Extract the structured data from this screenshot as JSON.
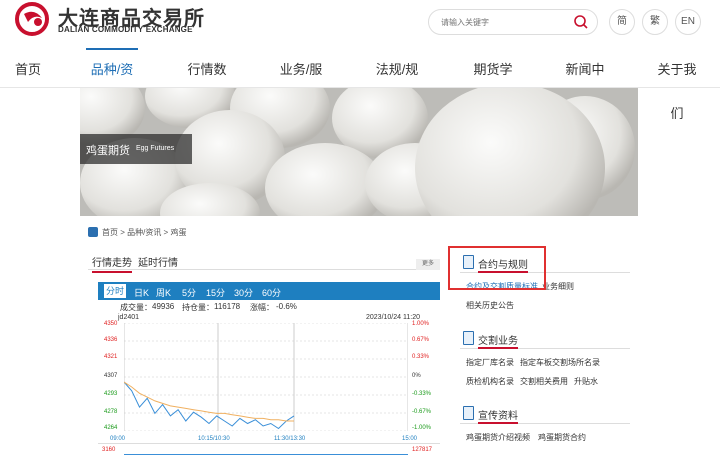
{
  "header": {
    "logo_cn": "大连商品交易所",
    "logo_en": "DALIAN COMMODITY EXCHANGE",
    "search_placeholder": "请输入关键字",
    "lang_simplified": "简",
    "lang_traditional": "繁",
    "lang_english": "EN"
  },
  "nav": {
    "items": [
      "首页",
      "品种/资讯",
      "行情数据",
      "业务/服务",
      "法规/规则",
      "期货学苑",
      "新闻中心",
      "关于我们"
    ],
    "active_index": 1
  },
  "banner": {
    "title_cn": "鸡蛋期货",
    "title_en": "Egg Futures"
  },
  "breadcrumb": "首页 > 品种/资讯 > 鸡蛋",
  "market": {
    "tabs": [
      "行情走势",
      "延时行情"
    ],
    "more": "更多",
    "periods": [
      "分时",
      "日K",
      "周K",
      "5分",
      "15分",
      "30分",
      "60分"
    ],
    "volume_label": "成交量：",
    "volume": "49936",
    "open_interest_label": "持仓量：",
    "open_interest": "116178",
    "change_label": "涨幅：",
    "change": "-0.6%",
    "symbol": "jd2401",
    "datetime": "2023/10/24 11:20",
    "bottom_left": "3160",
    "bottom_right": "127817"
  },
  "chart_data": {
    "type": "line",
    "y_ticks_left": [
      "4350",
      "4336",
      "4321",
      "4307",
      "4293",
      "4278",
      "4264"
    ],
    "y_ticks_right": [
      "1.00%",
      "0.67%",
      "0.33%",
      "0%",
      "-0.33%",
      "-0.67%",
      "-1.00%"
    ],
    "x_ticks": [
      "09:00",
      "10:15/10:30",
      "11:30/13:30",
      "15:00"
    ],
    "ylim": [
      4264,
      4350
    ],
    "series": [
      {
        "values": [
          4303,
          4296,
          4283,
          4290,
          4278,
          4285,
          4276,
          4281,
          4272,
          4279,
          4275,
          4270,
          4276,
          4272,
          4268,
          4274,
          4270,
          4273,
          4268,
          4270,
          4266,
          4272,
          4276
        ]
      },
      {
        "values": [
          4303,
          4299,
          4294,
          4291,
          4288,
          4286,
          4284,
          4283,
          4282,
          4281,
          4280,
          4279,
          4278,
          4278,
          4277,
          4276,
          4275,
          4274,
          4274,
          4273,
          4273,
          4272,
          4272
        ]
      }
    ],
    "colors": {
      "price": "#3a8fd8",
      "average": "#f0b060"
    }
  },
  "sections": [
    {
      "title": "合约与规则",
      "links": [
        "合约及交割质量标准",
        "业务细则",
        "相关历史公告"
      ]
    },
    {
      "title": "交割业务",
      "links": [
        "指定厂库名录",
        "指定车板交割场所名录",
        "质检机构名录",
        "交割相关费用",
        "升贴水"
      ]
    },
    {
      "title": "宣传资料",
      "links": [
        "鸡蛋期货介绍视频",
        "鸡蛋期货合约"
      ]
    }
  ],
  "colors": {
    "accent": "#1e6eb5",
    "brand_red": "#c8102e",
    "chart_bar": "#1e7fc0"
  }
}
